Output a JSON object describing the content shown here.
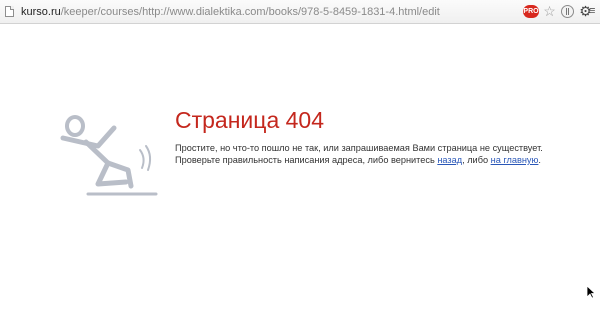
{
  "address_bar": {
    "host": "kurso.ru",
    "path": "/keeper/courses/http://www.dialektika.com/books/978-5-8459-1831-4.html/edit"
  },
  "toolbar": {
    "extension_badge": "PRO",
    "icons": [
      "page-icon",
      "star-icon",
      "extension-icon",
      "gear-icon",
      "wrench-icon"
    ]
  },
  "error": {
    "title": "Страница 404",
    "line1": "Простите, но что-то пошло не так, или запрашиваемая Вами страница не существует.",
    "line2_before": "Проверьте правильность написания адреса, либо вернитесь ",
    "back_link": "назад",
    "line2_middle": ", либо ",
    "home_link": "на главную",
    "line2_after": "."
  },
  "colors": {
    "title": "#c4271d",
    "link": "#2a57b8",
    "illustration": "#b9bec8"
  }
}
